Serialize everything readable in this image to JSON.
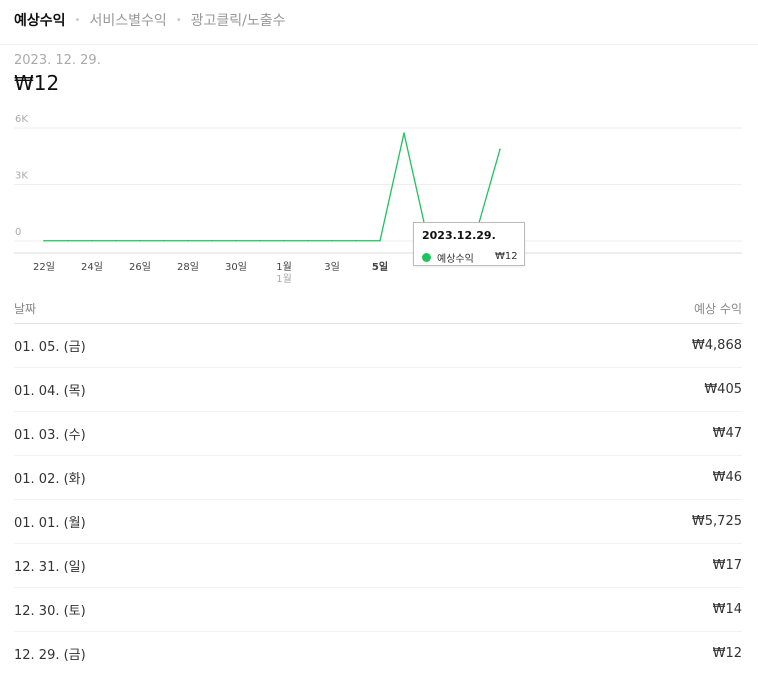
{
  "tabs": [
    {
      "label": "예상수익",
      "active": true
    },
    {
      "label": "서비스별수익",
      "active": false
    },
    {
      "label": "광고클릭/노출수",
      "active": false
    }
  ],
  "separator": "•",
  "selected": {
    "date": "2023. 12. 29.",
    "value": "₩12"
  },
  "chart_data": {
    "type": "line",
    "series": [
      {
        "name": "예상수익",
        "color": "#1ec35f",
        "values": [
          12,
          12,
          12,
          12,
          12,
          12,
          12,
          12,
          12,
          12,
          12,
          12,
          12,
          12,
          12,
          5725,
          46,
          47,
          405,
          4868
        ]
      }
    ],
    "x_tick_labels": [
      "22일",
      "24일",
      "26일",
      "28일",
      "30일",
      "1월",
      "3일",
      "5일"
    ],
    "x_sub_label": "1월",
    "y_tick_labels": [
      "6K",
      "3K",
      "0"
    ],
    "ylim": [
      0,
      6000
    ],
    "grid": true
  },
  "tooltip": {
    "title": "2023.12.29.",
    "series_label": "예상수익",
    "value": "₩12"
  },
  "table": {
    "headers": {
      "date": "날짜",
      "revenue": "예상 수익"
    },
    "rows": [
      {
        "date": "01. 05. (금)",
        "value": "₩4,868"
      },
      {
        "date": "01. 04. (목)",
        "value": "₩405"
      },
      {
        "date": "01. 03. (수)",
        "value": "₩47"
      },
      {
        "date": "01. 02. (화)",
        "value": "₩46"
      },
      {
        "date": "01. 01. (월)",
        "value": "₩5,725"
      },
      {
        "date": "12. 31. (일)",
        "value": "₩17"
      },
      {
        "date": "12. 30. (토)",
        "value": "₩14"
      },
      {
        "date": "12. 29. (금)",
        "value": "₩12"
      }
    ]
  }
}
